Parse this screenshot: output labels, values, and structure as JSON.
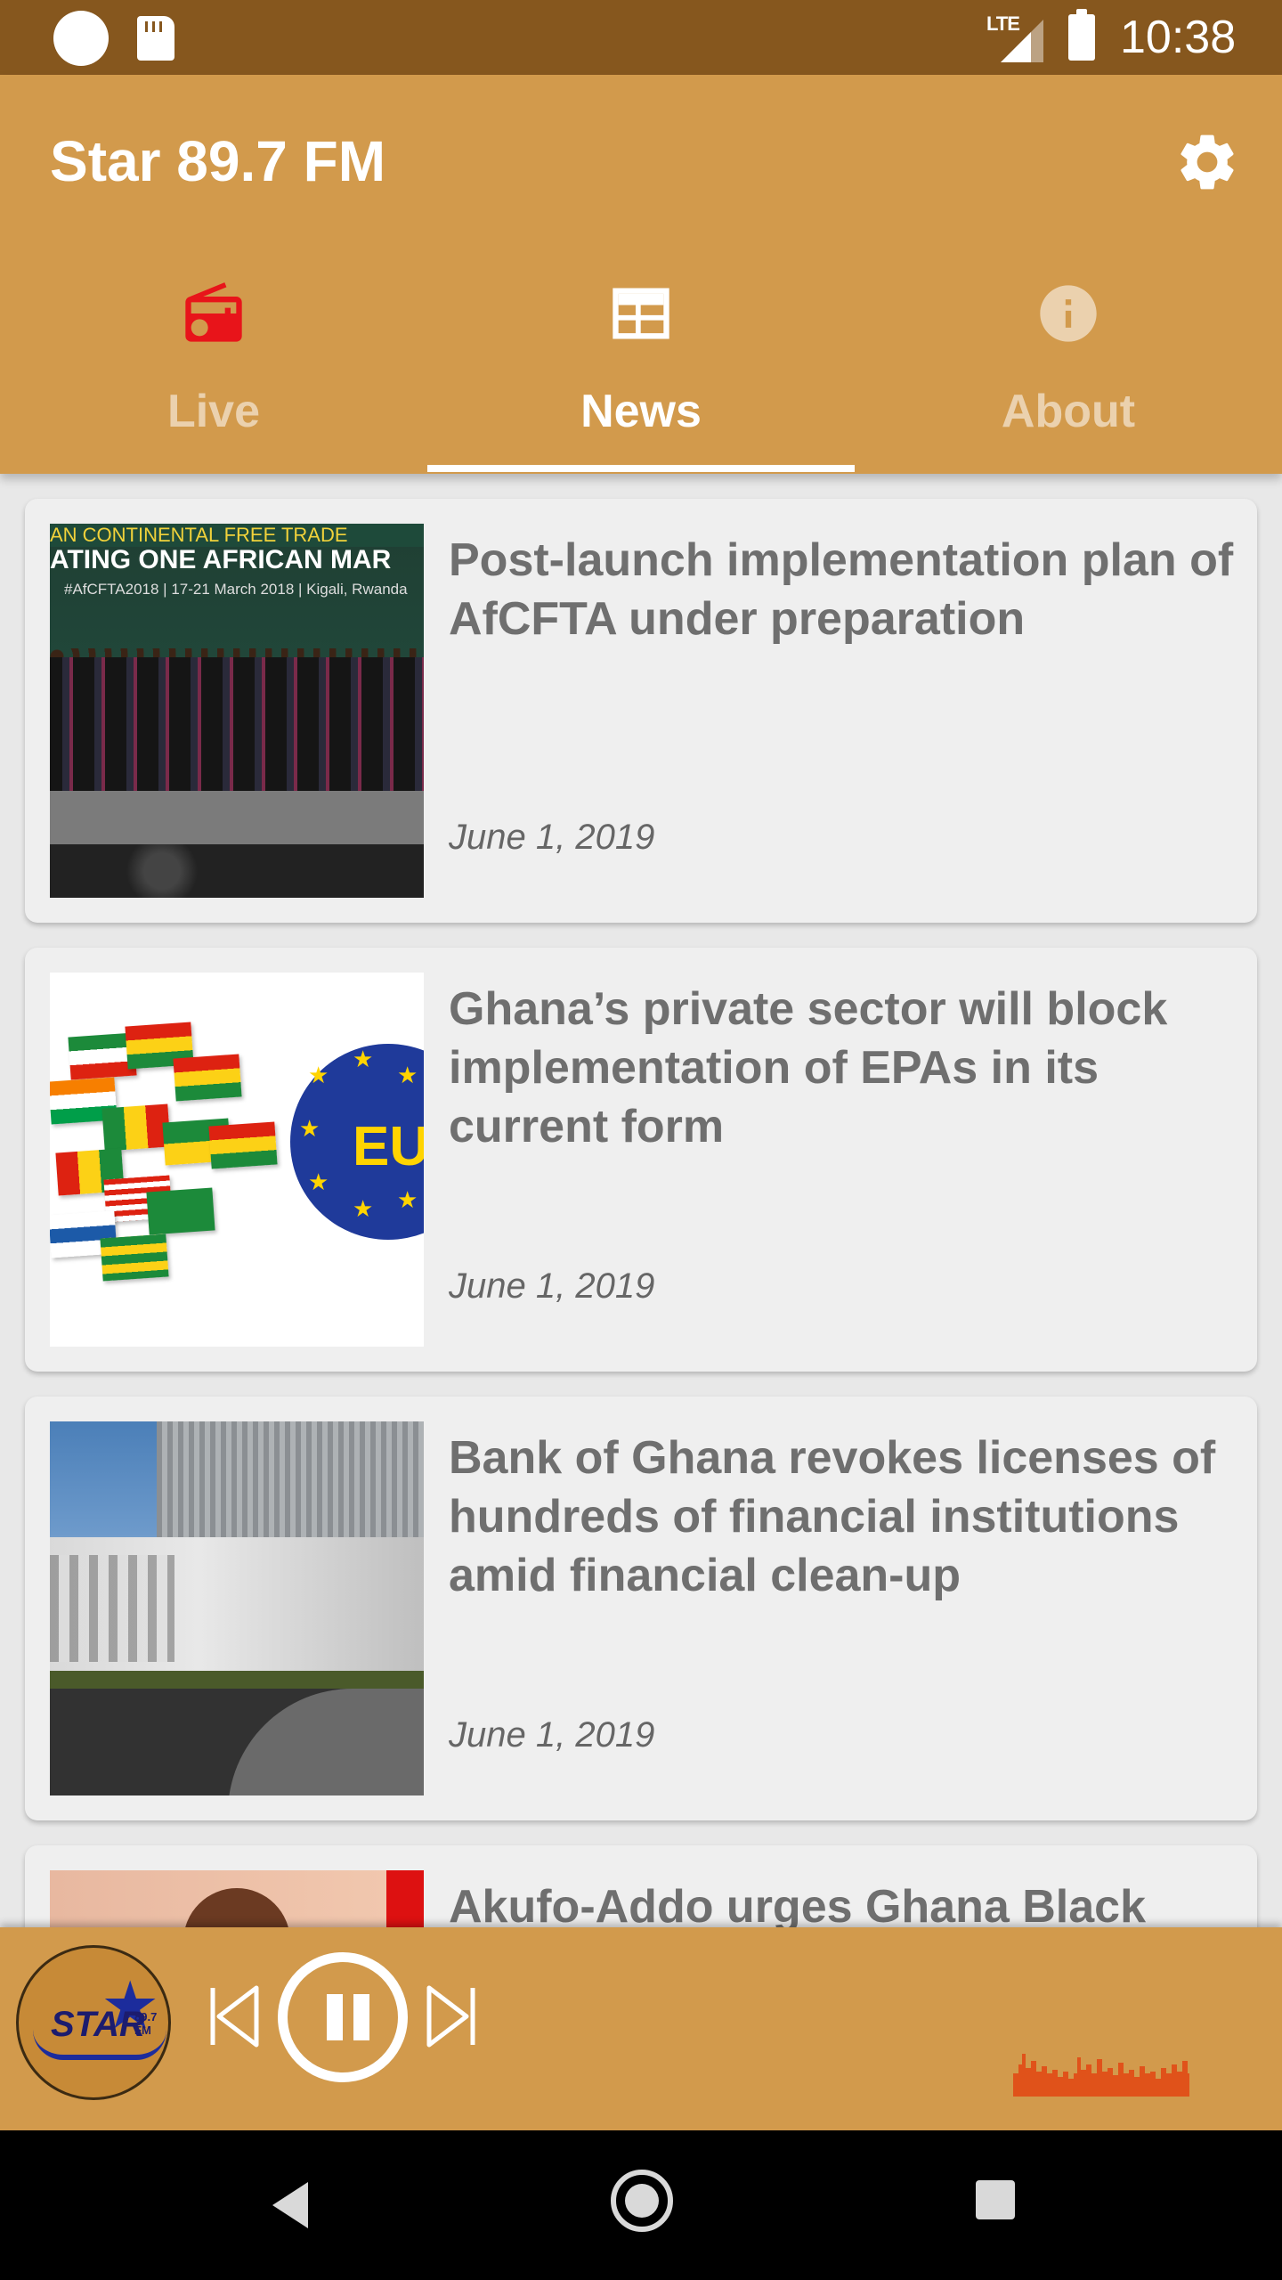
{
  "status_bar": {
    "network": "LTE",
    "time": "10:38"
  },
  "app_bar": {
    "title": "Star 89.7 FM"
  },
  "tabs": [
    {
      "label": "Live",
      "icon": "radio-icon",
      "active": false
    },
    {
      "label": "News",
      "icon": "newspaper-icon",
      "active": true
    },
    {
      "label": "About",
      "icon": "info-icon",
      "active": false
    }
  ],
  "news": [
    {
      "title": "Post-launch implementation plan of AfCFTA under preparation",
      "date": "June 1, 2019",
      "image_text": [
        "AN CONTINENTAL FREE TRADE",
        "ATING ONE AFRICAN MAR",
        "#AfCFTA2018 | 17-21 March 2018 | Kigali, Rwanda"
      ]
    },
    {
      "title": "Ghana’s private sector will block implementation of EPAs in its current form",
      "date": "June 1, 2019",
      "image_text": [
        "EU"
      ]
    },
    {
      "title": "Bank of Ghana revokes licenses of hundreds of financial institutions amid financial clean-up",
      "date": "June 1, 2019"
    },
    {
      "title": "Akufo-Addo urges Ghana Black"
    }
  ],
  "player": {
    "logo_text": "STAR",
    "logo_sub": "89.7 FM",
    "state": "playing"
  },
  "colors": {
    "status_bar": "#86571e",
    "primary": "#d29a4c",
    "live_icon": "#e8141a",
    "visualizer": "#e0521a",
    "card_bg": "#efefef",
    "text": "#6f6f6f"
  }
}
